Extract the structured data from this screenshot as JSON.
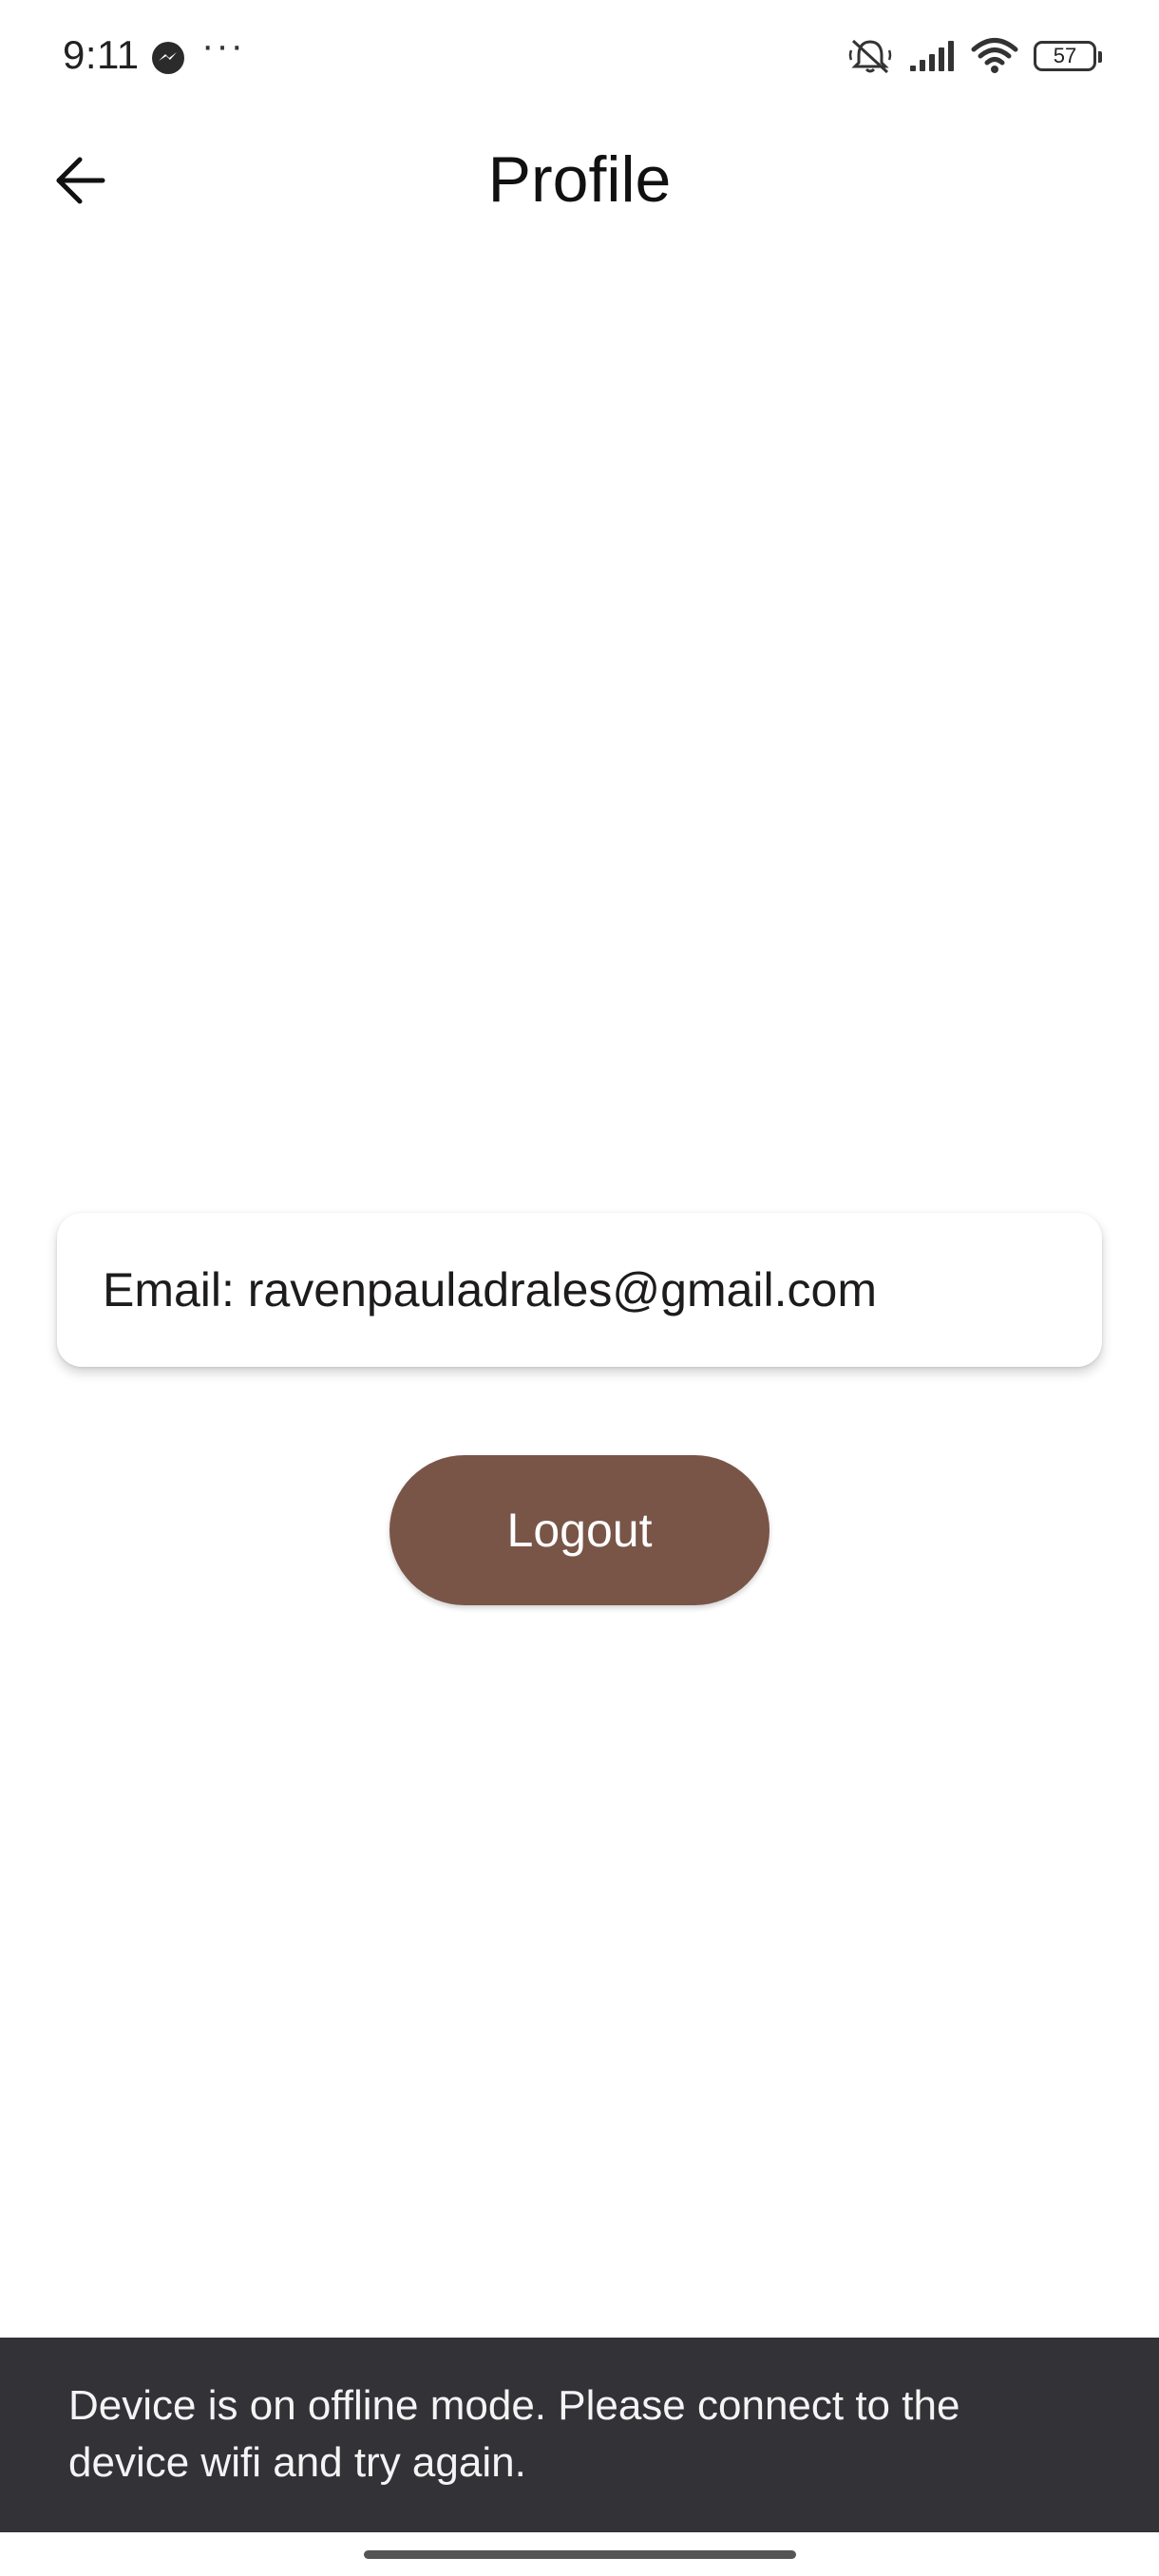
{
  "status_bar": {
    "time": "9:11",
    "messenger_icon": "messenger-icon",
    "more_indicator": "···",
    "icons": [
      "silent-bell-icon",
      "signal-icon",
      "wifi-icon"
    ],
    "battery_level": "57"
  },
  "app_bar": {
    "back_icon": "arrow-left-icon",
    "title": "Profile"
  },
  "profile": {
    "email_line": "Email: ravenpauladrales@gmail.com"
  },
  "actions": {
    "logout_label": "Logout"
  },
  "snackbar": {
    "message": "Device is on offline mode. Please connect to the device wifi and try again."
  },
  "colors": {
    "logout_button": "#795548",
    "snackbar_bg": "#333237",
    "background": "#ffffff"
  }
}
